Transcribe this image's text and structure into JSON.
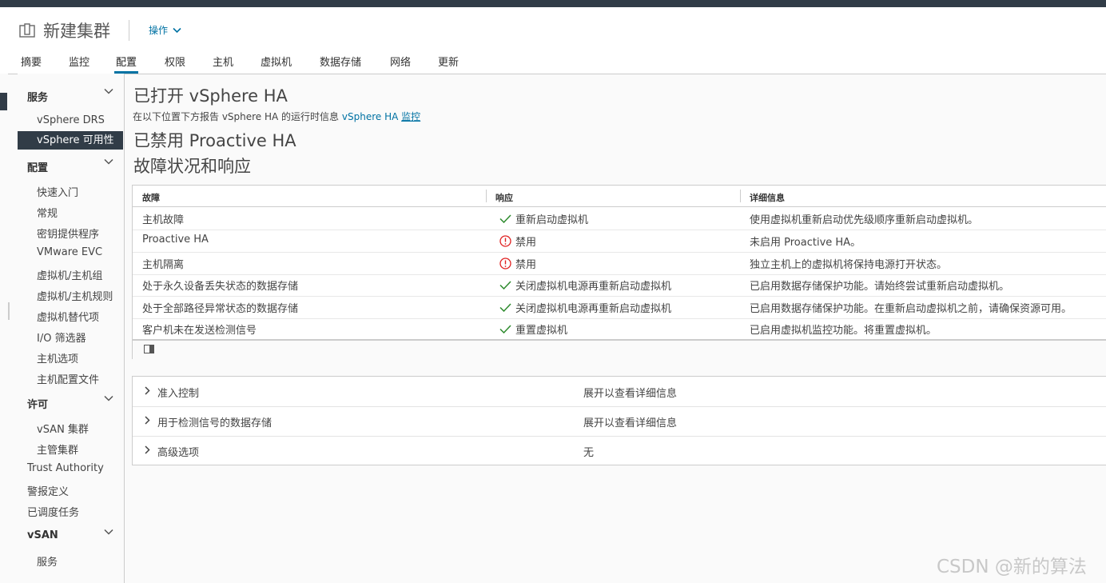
{
  "header": {
    "title": "新建集群",
    "actions_label": "操作",
    "icons": {
      "object": "cluster-icon",
      "dropdown": "chevron-down-icon"
    }
  },
  "tabs": [
    {
      "label": "摘要"
    },
    {
      "label": "监控"
    },
    {
      "label": "配置",
      "active": true
    },
    {
      "label": "权限"
    },
    {
      "label": "主机"
    },
    {
      "label": "虚拟机"
    },
    {
      "label": "数据存储"
    },
    {
      "label": "网络"
    },
    {
      "label": "更新"
    }
  ],
  "sidebar": {
    "groups": [
      {
        "label": "服务",
        "expanded": true,
        "items": [
          "vSphere DRS",
          "vSphere 可用性"
        ]
      },
      {
        "label": "配置",
        "expanded": true,
        "items": [
          "快速入门",
          "常规",
          "密钥提供程序",
          "VMware EVC",
          "虚拟机/主机组",
          "虚拟机/主机规则",
          "虚拟机替代项",
          "I/O 筛选器",
          "主机选项",
          "主机配置文件"
        ]
      },
      {
        "label": "许可",
        "expanded": true,
        "items": [
          "vSAN 集群",
          "主管集群"
        ]
      },
      {
        "label": "vSAN",
        "expanded": true,
        "items": [
          "服务"
        ]
      }
    ],
    "top_items": [
      "Trust Authority",
      "警报定义",
      "已调度任务"
    ],
    "selected": "vSphere 可用性"
  },
  "main": {
    "ha_title": "已打开 vSphere HA",
    "info_prefix": "在以下位置下方报告 vSphere HA 的运行时信息",
    "info_link1": "vSphere HA",
    "info_link2": "监控",
    "proactive_title": "已禁用 Proactive HA",
    "failures_title": "故障状况和响应"
  },
  "failures_table": {
    "columns": [
      "故障",
      "响应",
      "详细信息"
    ],
    "rows": [
      {
        "failure": "主机故障",
        "status": "ok",
        "response": "重新启动虚拟机",
        "details": "使用虚拟机重新启动优先级顺序重新启动虚拟机。"
      },
      {
        "failure": "Proactive HA",
        "status": "warning",
        "response": "禁用",
        "details": "未启用 Proactive HA。"
      },
      {
        "failure": "主机隔离",
        "status": "warning",
        "response": "禁用",
        "details": "独立主机上的虚拟机将保持电源打开状态。"
      },
      {
        "failure": "处于永久设备丢失状态的数据存储",
        "status": "ok",
        "response": "关闭虚拟机电源再重新启动虚拟机",
        "details": "已启用数据存储保护功能。请始终尝试重新启动虚拟机。"
      },
      {
        "failure": "处于全部路径异常状态的数据存储",
        "status": "ok",
        "response": "关闭虚拟机电源再重新启动虚拟机",
        "details": "已启用数据存储保护功能。在重新启动虚拟机之前，请确保资源可用。"
      },
      {
        "failure": "客户机未在发送检测信号",
        "status": "ok",
        "response": "重置虚拟机",
        "details": "已启用虚拟机监控功能。将重置虚拟机。"
      }
    ],
    "colors": {
      "ok": "#2e8b2e",
      "warning": "#e02020"
    }
  },
  "stack_view": [
    {
      "label": "准入控制",
      "value": "展开以查看详细信息"
    },
    {
      "label": "用于检测信号的数据存储",
      "value": "展开以查看详细信息"
    },
    {
      "label": "高级选项",
      "value": "无"
    }
  ],
  "watermark": "CSDN @新的算法",
  "colors": {
    "accent": "#0072a3",
    "nav_dark": "#313c47"
  }
}
